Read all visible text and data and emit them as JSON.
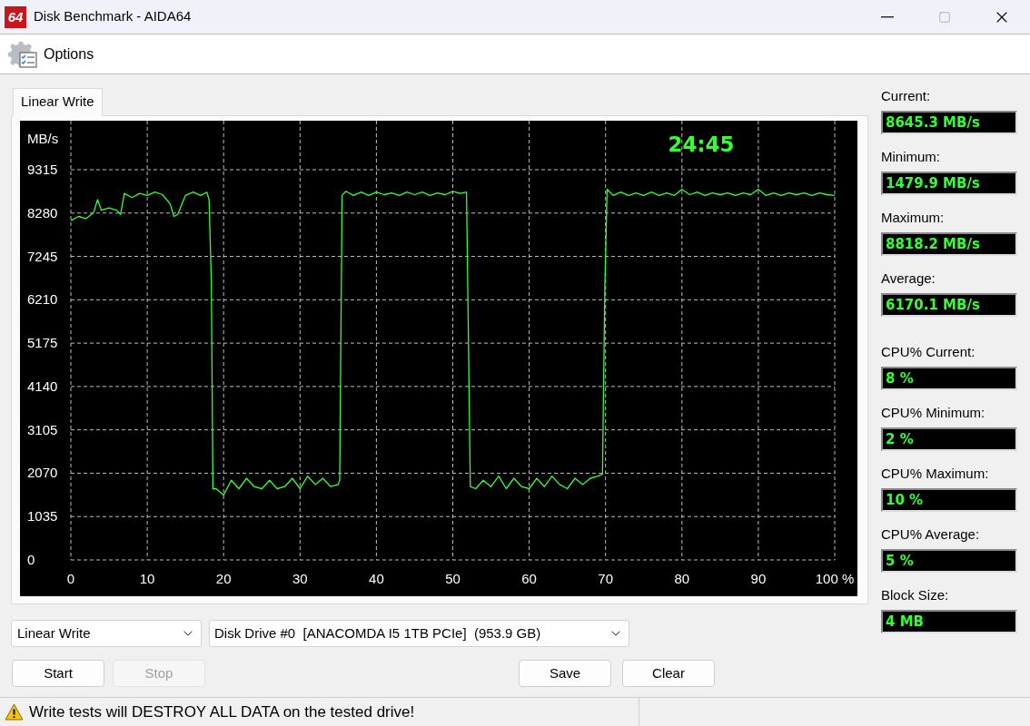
{
  "window": {
    "app_icon": "64",
    "title": "Disk Benchmark - AIDA64"
  },
  "toolbar": {
    "items": [
      {
        "label": "Options"
      }
    ]
  },
  "tabs": [
    {
      "label": "Linear Write",
      "selected": true
    }
  ],
  "chart": {
    "chart_data": {
      "type": "line",
      "ylabel": "MB/s",
      "grid": true,
      "color": "#33ff33",
      "annotations": [
        "24:45"
      ],
      "xlim": [
        0,
        100
      ],
      "ylim": [
        0,
        10485
      ],
      "xticks": [
        0,
        10,
        20,
        30,
        40,
        50,
        60,
        70,
        80,
        90,
        {
          "value": 100,
          "label": "100 %"
        }
      ],
      "yticks": [
        0,
        1035,
        2070,
        3105,
        4140,
        5175,
        6210,
        7245,
        8280,
        9315
      ],
      "x": [
        0,
        1,
        2,
        3,
        3.5,
        4,
        5,
        6,
        6.5,
        7,
        8,
        9,
        10,
        11,
        12,
        13,
        13.5,
        14,
        15,
        16,
        17,
        17.8,
        18.1,
        18.4,
        18.6,
        19,
        20,
        21,
        22,
        23,
        24,
        25,
        26,
        27,
        28,
        29,
        30,
        31,
        32,
        33,
        34,
        35,
        35.2,
        35.5,
        36,
        37,
        38,
        39,
        40,
        41,
        42,
        43,
        44,
        45,
        46,
        47,
        48,
        49,
        50,
        51,
        51.8,
        52,
        52.3,
        53,
        54,
        55,
        56,
        57,
        58,
        59,
        60,
        61,
        62,
        63,
        64,
        65,
        66,
        67,
        68,
        69,
        69.6,
        69.9,
        70.2,
        71,
        72,
        73,
        74,
        75,
        76,
        77,
        78,
        79,
        80,
        81,
        82,
        83,
        84,
        85,
        86,
        87,
        88,
        89,
        90,
        91,
        92,
        93,
        94,
        95,
        96,
        97,
        98,
        99,
        100
      ],
      "values": [
        8100,
        8200,
        8150,
        8300,
        8600,
        8350,
        8400,
        8350,
        8250,
        8750,
        8650,
        8750,
        8700,
        8780,
        8720,
        8500,
        8200,
        8250,
        8700,
        8780,
        8700,
        8780,
        8600,
        6600,
        1700,
        1700,
        1550,
        1900,
        1700,
        1950,
        1750,
        1700,
        1900,
        1700,
        1750,
        1950,
        1700,
        2000,
        1800,
        1950,
        1750,
        1800,
        1900,
        8700,
        8800,
        8700,
        8780,
        8700,
        8780,
        8720,
        8760,
        8700,
        8780,
        8720,
        8780,
        8700,
        8760,
        8720,
        8800,
        8750,
        8780,
        6000,
        1750,
        1700,
        1900,
        1750,
        2000,
        1700,
        1950,
        1750,
        1700,
        1950,
        1750,
        2000,
        1800,
        1700,
        1950,
        1800,
        1950,
        2000,
        2050,
        6500,
        8850,
        8700,
        8780,
        8700,
        8760,
        8700,
        8780,
        8700,
        8760,
        8700,
        8850,
        8720,
        8780,
        8700,
        8760,
        8720,
        8760,
        8700,
        8760,
        8720,
        8850,
        8700,
        8760,
        8700,
        8760,
        8720,
        8760,
        8700,
        8760,
        8720,
        8700
      ]
    }
  },
  "speed_readings": [
    {
      "label": "Current:",
      "value": "8645.3 MB/s"
    },
    {
      "label": "Minimum:",
      "value": "1479.9 MB/s"
    },
    {
      "label": "Maximum:",
      "value": "8818.2 MB/s"
    },
    {
      "label": "Average:",
      "value": "6170.1 MB/s"
    }
  ],
  "other_readings": [
    {
      "label": "CPU% Current:",
      "value": "8 %"
    },
    {
      "label": "CPU% Minimum:",
      "value": "2 %"
    },
    {
      "label": "CPU% Maximum:",
      "value": "10 %"
    },
    {
      "label": "CPU% Average:",
      "value": "5 %"
    },
    {
      "label": "Block Size:",
      "value": "4 MB"
    }
  ],
  "test_select": {
    "value": "Linear Write"
  },
  "drive_select": {
    "value": "Disk Drive #0  [ANACOMDA I5 1TB PCIe]  (953.9 GB)"
  },
  "left_buttons": [
    {
      "label": "Start",
      "disabled": false
    },
    {
      "label": "Stop",
      "disabled": true
    }
  ],
  "right_buttons": [
    {
      "label": "Save",
      "disabled": false
    },
    {
      "label": "Clear",
      "disabled": false
    }
  ],
  "status_bar": {
    "message": "Write tests will DESTROY ALL DATA on the tested drive!"
  }
}
